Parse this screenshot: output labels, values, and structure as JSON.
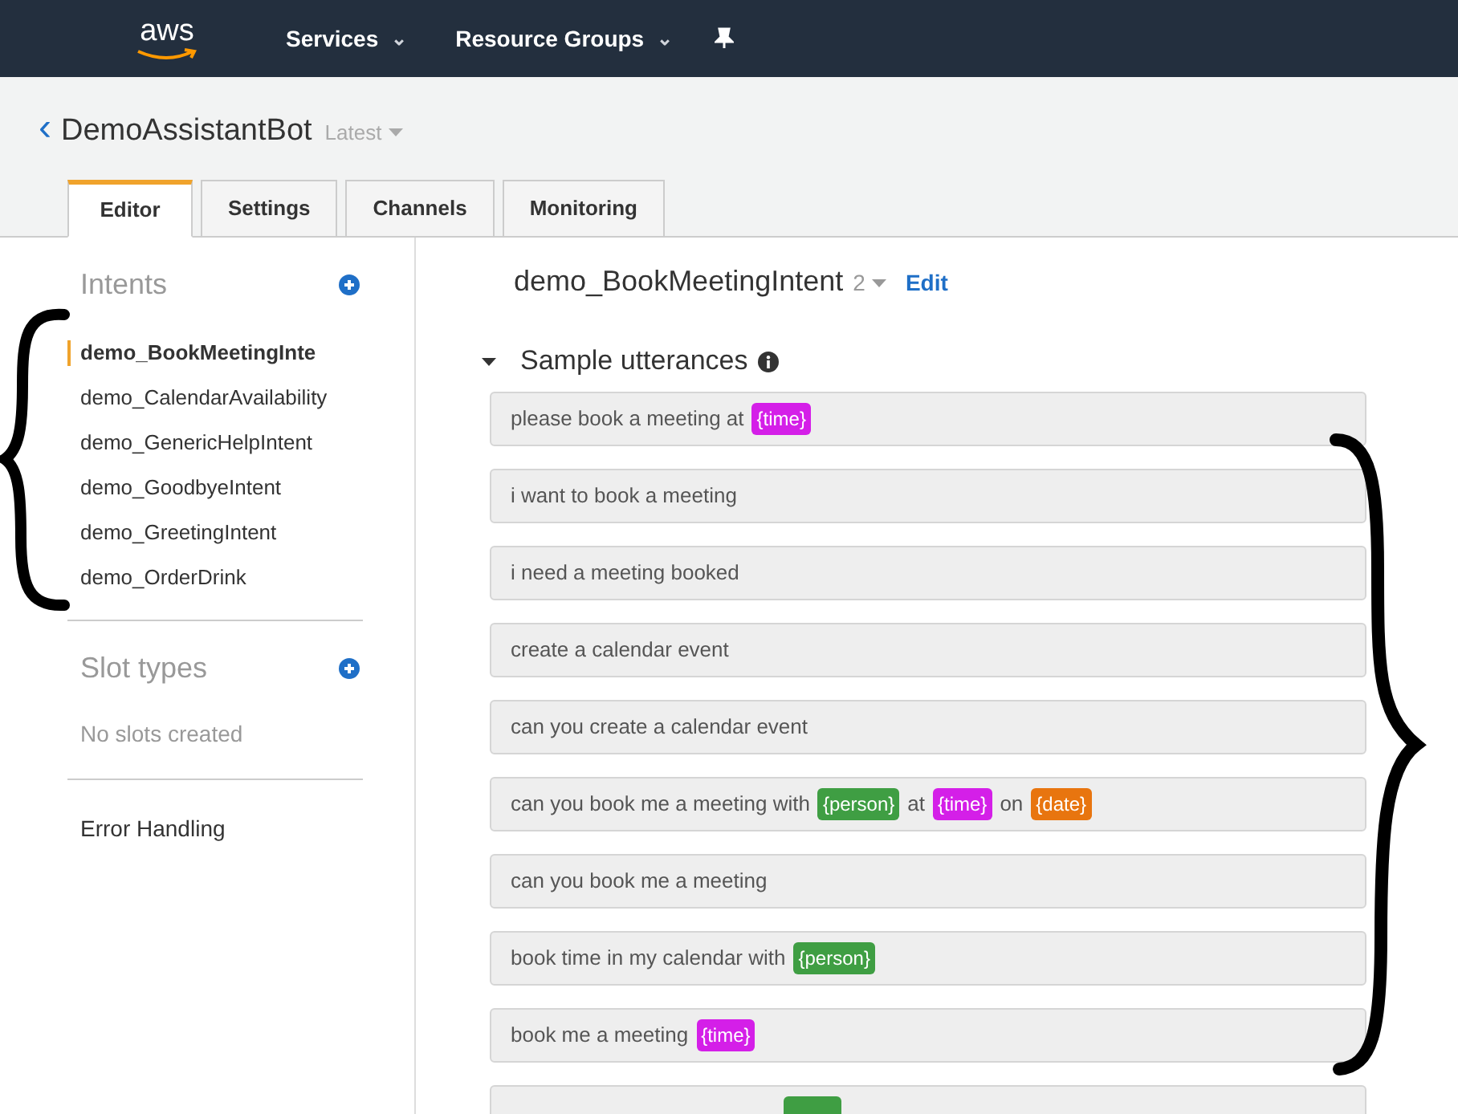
{
  "nav": {
    "logo": "aws",
    "menus": [
      {
        "label": "Services",
        "caret": "⌄"
      },
      {
        "label": "Resource Groups",
        "caret": "⌄"
      }
    ]
  },
  "header": {
    "back": "‹",
    "bot_name": "DemoAssistantBot",
    "version": "Latest"
  },
  "tabs": [
    {
      "label": "Editor",
      "selected": true
    },
    {
      "label": "Settings",
      "selected": false
    },
    {
      "label": "Channels",
      "selected": false
    },
    {
      "label": "Monitoring",
      "selected": false
    }
  ],
  "sidebar": {
    "intents_heading": "Intents",
    "intents": [
      {
        "label": "demo_BookMeetingInte",
        "selected": true
      },
      {
        "label": "demo_CalendarAvailability",
        "selected": false
      },
      {
        "label": "demo_GenericHelpIntent",
        "selected": false
      },
      {
        "label": "demo_GoodbyeIntent",
        "selected": false
      },
      {
        "label": "demo_GreetingIntent",
        "selected": false
      },
      {
        "label": "demo_OrderDrink",
        "selected": false
      }
    ],
    "slot_types_heading": "Slot types",
    "slot_types_empty": "No slots created",
    "error_handling": "Error Handling"
  },
  "intent": {
    "name": "demo_BookMeetingIntent",
    "version": "2",
    "edit": "Edit"
  },
  "section": {
    "title": "Sample utterances",
    "expanded": true
  },
  "utterances": [
    {
      "parts": [
        {
          "text": "please book a meeting at"
        },
        {
          "text": "{time}",
          "color": "#d41fe8"
        }
      ]
    },
    {
      "parts": [
        {
          "text": "i want to book a meeting"
        }
      ]
    },
    {
      "parts": [
        {
          "text": "i need a meeting booked"
        }
      ]
    },
    {
      "parts": [
        {
          "text": "create a calendar event"
        }
      ]
    },
    {
      "parts": [
        {
          "text": "can you create a calendar event"
        }
      ]
    },
    {
      "parts": [
        {
          "text": "can you book me a meeting with"
        },
        {
          "text": "{person}",
          "color": "#3f9e43"
        },
        {
          "text": "at"
        },
        {
          "text": "{time}",
          "color": "#d41fe8"
        },
        {
          "text": "on"
        },
        {
          "text": "{date}",
          "color": "#e8750f"
        }
      ]
    },
    {
      "parts": [
        {
          "text": "can you book me a meeting"
        }
      ]
    },
    {
      "parts": [
        {
          "text": "book time in my calendar with"
        },
        {
          "text": "{person}",
          "color": "#3f9e43"
        }
      ]
    },
    {
      "parts": [
        {
          "text": "book me a meeting"
        },
        {
          "text": "{time}",
          "color": "#d41fe8"
        }
      ]
    },
    {
      "parts": [
        {
          "color": "#3f9e43"
        }
      ]
    }
  ]
}
